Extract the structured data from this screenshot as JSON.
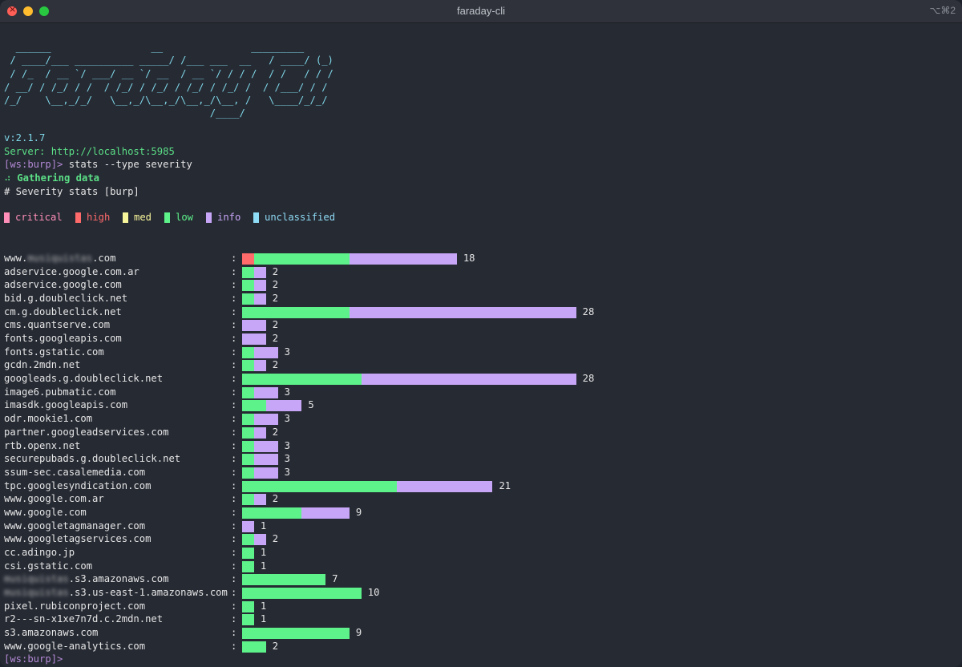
{
  "window": {
    "title": "faraday-cli",
    "shortcut": "⌥⌘2"
  },
  "banner": [
    "  ______                 __               _________",
    " / ____/___ __________ _____/ /___ ___  __   / ____/ (_)",
    " / /_  / __ `/ ___/ __ `/ __  / __ `/ / / /  / /   / / /",
    "/ __/ / /_/ / /  / /_/ / /_/ / /_/ / /_/ /  / /___/ / /",
    "/_/    \\__,_/_/   \\__,_/\\__,_/\\__,_/\\__, /   \\____/_/_/",
    "                                   /____/"
  ],
  "version": "v:2.1.7",
  "server": "Server: http://localhost:5985",
  "prompt": "[ws:burp]>",
  "command": " stats --type severity",
  "gathering_icon": "⠴",
  "gathering": "Gathering data",
  "stats_header": "# Severity stats [burp]",
  "colors": {
    "critical": "#ff8fb8",
    "high": "#ff6a6a",
    "med": "#f8f69a",
    "low": "#5df28a",
    "info": "#c7a6f7",
    "unclassified": "#8fdcf6"
  },
  "legend": [
    {
      "key": "critical",
      "label": "critical"
    },
    {
      "key": "high",
      "label": "high"
    },
    {
      "key": "med",
      "label": "med"
    },
    {
      "key": "low",
      "label": "low"
    },
    {
      "key": "info",
      "label": "info"
    },
    {
      "key": "unclassified",
      "label": "unclassified"
    }
  ],
  "rows": [
    {
      "host_prefix": "www.",
      "blur": "musiquistas",
      "host_suffix": ".com",
      "high": 1,
      "low": 8,
      "info": 9,
      "total": "18"
    },
    {
      "host": "adservice.google.com.ar",
      "low": 1,
      "info": 1,
      "total": "2"
    },
    {
      "host": "adservice.google.com",
      "low": 1,
      "info": 1,
      "total": "2"
    },
    {
      "host": "bid.g.doubleclick.net",
      "low": 1,
      "info": 1,
      "total": "2"
    },
    {
      "host": "cm.g.doubleclick.net",
      "low": 9,
      "info": 19,
      "total": "28"
    },
    {
      "host": "cms.quantserve.com",
      "info": 2,
      "total": "2"
    },
    {
      "host": "fonts.googleapis.com",
      "info": 2,
      "total": "2"
    },
    {
      "host": "fonts.gstatic.com",
      "low": 1,
      "info": 2,
      "total": "3"
    },
    {
      "host": "gcdn.2mdn.net",
      "low": 1,
      "info": 1,
      "total": "2"
    },
    {
      "host": "googleads.g.doubleclick.net",
      "low": 10,
      "info": 18,
      "total": "28"
    },
    {
      "host": "image6.pubmatic.com",
      "low": 1,
      "info": 2,
      "total": "3"
    },
    {
      "host": "imasdk.googleapis.com",
      "low": 2,
      "info": 3,
      "total": "5"
    },
    {
      "host": "odr.mookie1.com",
      "low": 1,
      "info": 2,
      "total": "3"
    },
    {
      "host": "partner.googleadservices.com",
      "low": 1,
      "info": 1,
      "total": "2"
    },
    {
      "host": "rtb.openx.net",
      "low": 1,
      "info": 2,
      "total": "3"
    },
    {
      "host": "securepubads.g.doubleclick.net",
      "low": 1,
      "info": 2,
      "total": "3"
    },
    {
      "host": "ssum-sec.casalemedia.com",
      "low": 1,
      "info": 2,
      "total": "3"
    },
    {
      "host": "tpc.googlesyndication.com",
      "low": 13,
      "info": 8,
      "total": "21"
    },
    {
      "host": "www.google.com.ar",
      "low": 1,
      "info": 1,
      "total": "2"
    },
    {
      "host": "www.google.com",
      "low": 5,
      "info": 4,
      "total": "9"
    },
    {
      "host": "www.googletagmanager.com",
      "info": 1,
      "total": "1"
    },
    {
      "host": "www.googletagservices.com",
      "low": 1,
      "info": 1,
      "total": "2"
    },
    {
      "host": "cc.adingo.jp",
      "low": 1,
      "total": "1"
    },
    {
      "host": "csi.gstatic.com",
      "low": 1,
      "total": "1"
    },
    {
      "host_prefix": "",
      "blur": "musiquistas",
      "host_suffix": ".s3.amazonaws.com",
      "low": 7,
      "total": "7"
    },
    {
      "host_prefix": "",
      "blur": "musiquistas",
      "host_suffix": ".s3.us-east-1.amazonaws.com",
      "low": 10,
      "total": "10"
    },
    {
      "host": "pixel.rubiconproject.com",
      "low": 1,
      "total": "1"
    },
    {
      "host": "r2---sn-x1xe7n7d.c.2mdn.net",
      "low": 1,
      "total": "1"
    },
    {
      "host": "s3.amazonaws.com",
      "low": 9,
      "total": "9"
    },
    {
      "host": "www.google-analytics.com",
      "low": 2,
      "total": "2"
    }
  ],
  "final_prompt": "[ws:burp]>"
}
